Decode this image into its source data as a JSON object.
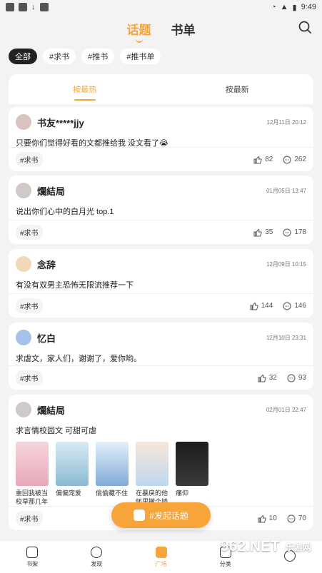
{
  "status": {
    "time": "9:49"
  },
  "header": {
    "tabs": [
      "话题",
      "书单"
    ]
  },
  "chips": [
    "全部",
    "#求书",
    "#推书",
    "#推书单"
  ],
  "sort": {
    "hot": "按最热",
    "new": "按最新"
  },
  "posts": [
    {
      "name": "书友*****jjy",
      "time": "12月11日 20:12",
      "content": "只要你们觉得好看的文都推给我 没文看了😭",
      "tag": "#求书",
      "likes": "82",
      "comments": "262"
    },
    {
      "name": "爛結局",
      "time": "01月05日 13:47",
      "content": "说出你们心中的白月光 top.1",
      "tag": "#求书",
      "likes": "35",
      "comments": "178"
    },
    {
      "name": "念辞",
      "time": "12月09日 10:15",
      "content": "有没有双男主恐怖无限流推荐一下",
      "tag": "#求书",
      "likes": "144",
      "comments": "146"
    },
    {
      "name": "忆白",
      "time": "12月10日 23:31",
      "content": "求虐文，家人们，谢谢了，爱你哟。",
      "tag": "#求书",
      "likes": "32",
      "comments": "93"
    },
    {
      "name": "爛結局",
      "time": "02月01日 22:47",
      "content": "求言情校园文 可甜可虐",
      "tag": "#求书",
      "likes": "10",
      "comments": "70",
      "books": [
        {
          "title": "重回我被当校草那几年"
        },
        {
          "title": "偏偏宠爱"
        },
        {
          "title": "偷偷藏不住"
        },
        {
          "title": "在暴戾的他怀里撒个娇"
        },
        {
          "title": "痛仰"
        }
      ]
    }
  ],
  "fab": {
    "label": "#发起话题"
  },
  "nav": [
    "书架",
    "发现",
    "广场",
    "分类",
    ""
  ],
  "watermark": {
    "text": "962.NET",
    "sub": "乐游网"
  },
  "colors": {
    "accent": "#f7a43b",
    "background": "#f3f3f3"
  }
}
